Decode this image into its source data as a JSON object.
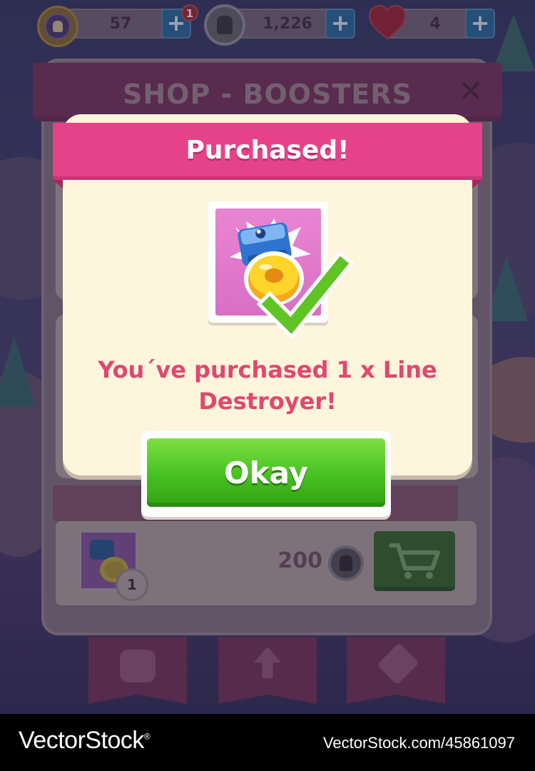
{
  "topbar": {
    "level_icon": "level-badge-icon",
    "lives_count": "57",
    "lives_notification": "1",
    "coins": "1,226",
    "hearts": "4",
    "plus_label": "+"
  },
  "shop": {
    "title": "SHOP - BOOSTERS",
    "close_label": "✕",
    "item": {
      "quantity": "1",
      "price": "200"
    },
    "tabs": [
      {
        "icon": "hand-pointer-icon"
      },
      {
        "icon": "arrow-up-icon"
      },
      {
        "icon": "price-tag-icon"
      }
    ]
  },
  "modal": {
    "title": "Purchased!",
    "message": "You´ve purchased 1 x Line Destroyer!",
    "button_label": "Okay"
  },
  "watermark": {
    "brand": "VectorStock",
    "brand_suffix": "®",
    "id_text": "VectorStock.com/45861097"
  },
  "colors": {
    "modal_header": "#e6428a",
    "modal_text": "#e2476e",
    "okay_green": "#46c021",
    "modal_bg": "#fdf5dc"
  }
}
